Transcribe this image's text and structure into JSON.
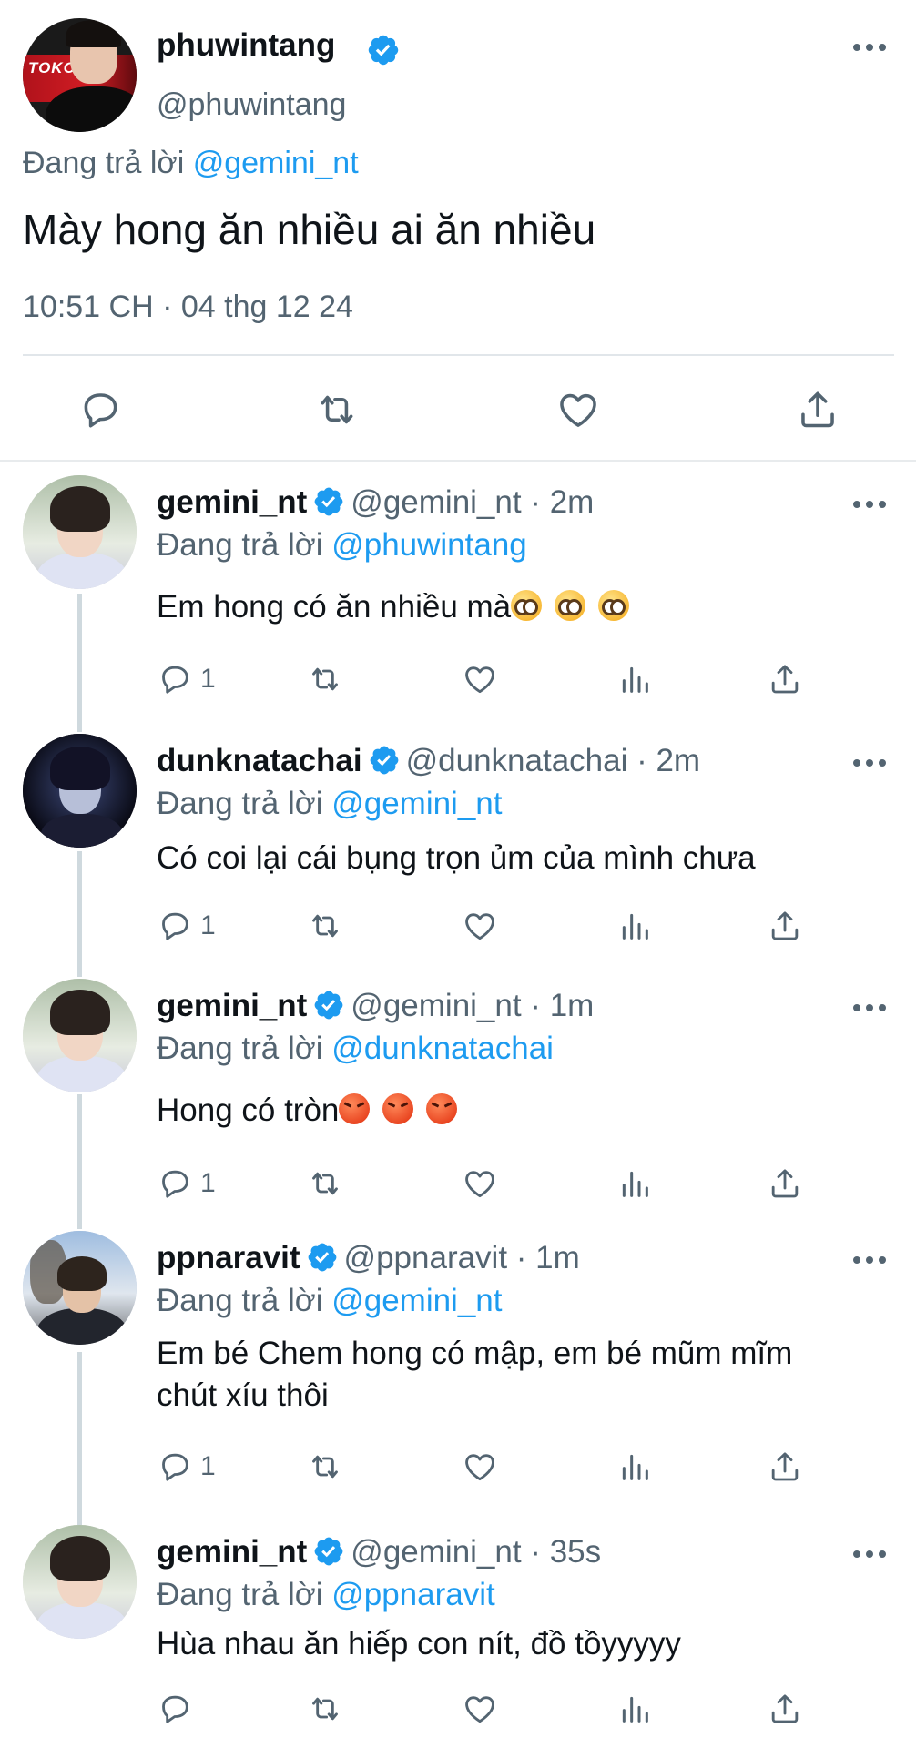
{
  "colors": {
    "link": "#1d9bf0",
    "secondary": "#536471",
    "verified": "#1d9bf0"
  },
  "main_tweet": {
    "display_name": "phuwintang",
    "handle": "@phuwintang",
    "replying_prefix": "Đang trả lời",
    "replying_to": "@gemini_nt",
    "text": "Mày hong ăn nhiều ai ăn nhiều",
    "timestamp": "10:51 CH · 04 thg 12 24",
    "avatar_text": "TOKCR",
    "icons": [
      "reply-icon",
      "retweet-icon",
      "like-icon",
      "share-icon"
    ]
  },
  "replies": [
    {
      "display_name": "gemini_nt",
      "meta": "@gemini_nt · 2m",
      "replying_prefix": "Đang trả lời",
      "replying_to": "@phuwintang",
      "text": "Em hong có ăn nhiều mà",
      "emoji": "pleading-face",
      "emoji_count": 3,
      "reply_count": "1"
    },
    {
      "display_name": "dunknatachai",
      "meta": "@dunknatachai · 2m",
      "replying_prefix": "Đang trả lời",
      "replying_to": "@gemini_nt",
      "text": "Có coi lại cái bụng trọn ủm của mình chưa",
      "reply_count": "1"
    },
    {
      "display_name": "gemini_nt",
      "meta": "@gemini_nt · 1m",
      "replying_prefix": "Đang trả lời",
      "replying_to": "@dunknatachai",
      "text": "Hong có tròn",
      "emoji": "angry-face",
      "emoji_count": 3,
      "reply_count": "1"
    },
    {
      "display_name": "ppnaravit",
      "meta": "@ppnaravit · 1m",
      "replying_prefix": "Đang trả lời",
      "replying_to": "@gemini_nt",
      "text_line1": "Em bé Chem hong có mập, em bé mũm mĩm",
      "text_line2": "chút xíu thôi",
      "reply_count": "1"
    },
    {
      "display_name": "gemini_nt",
      "meta": "@gemini_nt · 35s",
      "replying_prefix": "Đang trả lời",
      "replying_to": "@ppnaravit",
      "text": "Hùa nhau ăn hiếp con nít, đồ tồyyyyy",
      "reply_count": ""
    }
  ]
}
